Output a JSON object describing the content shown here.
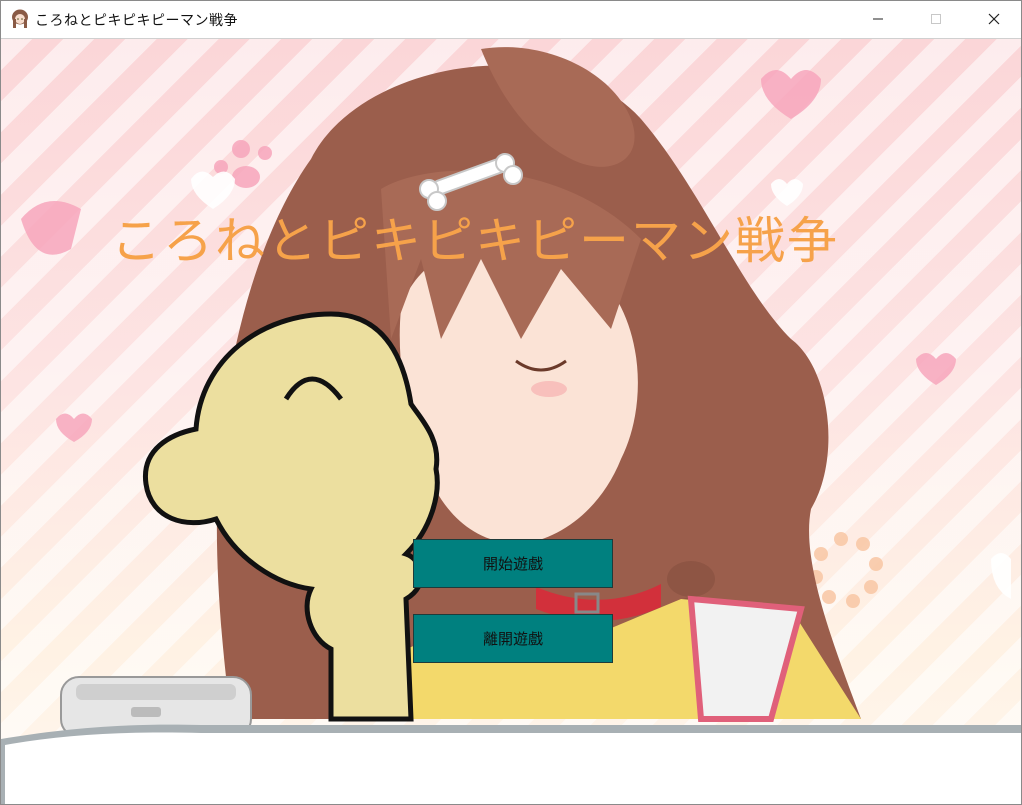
{
  "window": {
    "title": "ころねとピキピキピーマン戦争",
    "icon": "character-app-icon",
    "controls": [
      "minimize-icon",
      "maximize-icon",
      "close-icon"
    ]
  },
  "game": {
    "title_text": "ころねとピキピキピーマン戦争",
    "title_color": "#f6a24a",
    "button_color": "#00807f",
    "menu": {
      "start_label": "開始遊戲",
      "quit_label": "離開遊戲"
    }
  }
}
